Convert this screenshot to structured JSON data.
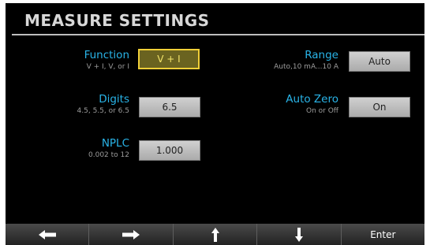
{
  "screen_title": "MEASURE SETTINGS",
  "settings": {
    "function": {
      "label": "Function",
      "hint": "V + I, V, or I",
      "value": "V + I"
    },
    "digits": {
      "label": "Digits",
      "hint": "4.5, 5.5, or 6.5",
      "value": "6.5"
    },
    "nplc": {
      "label": "NPLC",
      "hint": "0.002 to 12",
      "value": "1.000"
    },
    "range": {
      "label": "Range",
      "hint": "Auto,10 mA...10 A",
      "value": "Auto"
    },
    "auto_zero": {
      "label": "Auto Zero",
      "hint": "On or Off",
      "value": "On"
    }
  },
  "navbar": {
    "left": {
      "icon": "arrow-left-icon"
    },
    "right": {
      "icon": "arrow-right-icon"
    },
    "up": {
      "icon": "arrow-up-icon"
    },
    "down": {
      "icon": "arrow-down-icon"
    },
    "enter": {
      "label": "Enter"
    }
  },
  "colors": {
    "label": "#29b4e8",
    "hint": "#9c9c9c",
    "selected_border": "#f0cf38",
    "selected_text": "#f3e46a",
    "background": "#000000"
  }
}
